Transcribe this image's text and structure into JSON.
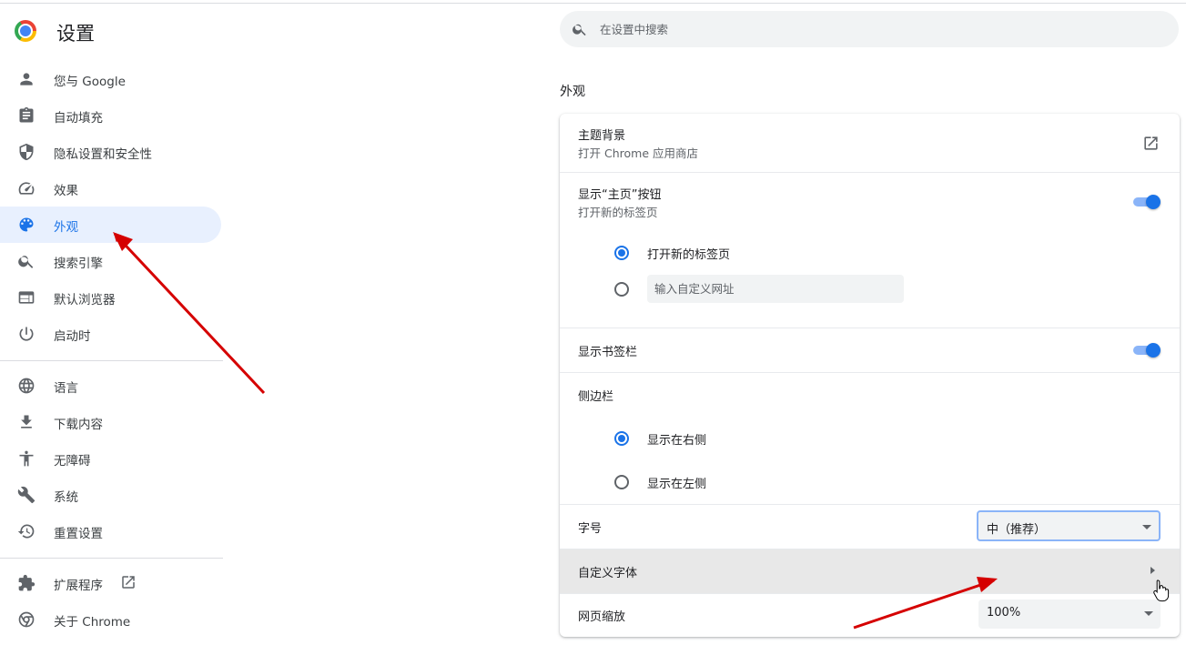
{
  "app": {
    "title": "设置",
    "brand_icon": "chrome-logo-icon"
  },
  "search": {
    "placeholder": "在设置中搜索",
    "value": ""
  },
  "sidebar": {
    "items": [
      {
        "label": "您与 Google",
        "icon": "person-icon"
      },
      {
        "label": "自动填充",
        "icon": "clipboard-icon"
      },
      {
        "label": "隐私设置和安全性",
        "icon": "shield-icon"
      },
      {
        "label": "效果",
        "icon": "speedometer-icon"
      },
      {
        "label": "外观",
        "icon": "palette-icon",
        "active": true
      },
      {
        "label": "搜索引擎",
        "icon": "search-icon"
      },
      {
        "label": "默认浏览器",
        "icon": "browser-window-icon"
      },
      {
        "label": "启动时",
        "icon": "power-icon"
      },
      {
        "label": "语言",
        "icon": "globe-icon"
      },
      {
        "label": "下载内容",
        "icon": "download-icon"
      },
      {
        "label": "无障碍",
        "icon": "accessibility-icon"
      },
      {
        "label": "系统",
        "icon": "wrench-icon"
      },
      {
        "label": "重置设置",
        "icon": "history-icon"
      },
      {
        "label": "扩展程序",
        "icon": "puzzle-icon",
        "external_link_icon": "open-in-new-icon"
      },
      {
        "label": "关于 Chrome",
        "icon": "chrome-icon"
      }
    ]
  },
  "main": {
    "section_title": "外观",
    "theme": {
      "title": "主题背景",
      "subtitle": "打开 Chrome 应用商店",
      "icon": "open-in-new-icon"
    },
    "home_button": {
      "title": "显示“主页”按钮",
      "subtitle": "打开新的标签页",
      "enabled": true,
      "options": [
        {
          "label": "打开新的标签页",
          "checked": true
        },
        {
          "label": "",
          "checked": false
        }
      ],
      "custom_url_placeholder": "输入自定义网址"
    },
    "bookmarks_bar": {
      "title": "显示书签栏",
      "enabled": true
    },
    "side_panel": {
      "title": "侧边栏",
      "options": [
        {
          "label": "显示在右侧",
          "checked": true
        },
        {
          "label": "显示在左侧",
          "checked": false
        }
      ]
    },
    "font_size": {
      "title": "字号",
      "value": "中（推荐）"
    },
    "custom_fonts": {
      "title": "自定义字体"
    },
    "page_zoom": {
      "title": "网页缩放",
      "value": "100%"
    }
  },
  "colors": {
    "accent": "#1a73e8",
    "active_nav_bg": "#e8f0fe",
    "annotation_arrow": "#d50000"
  }
}
